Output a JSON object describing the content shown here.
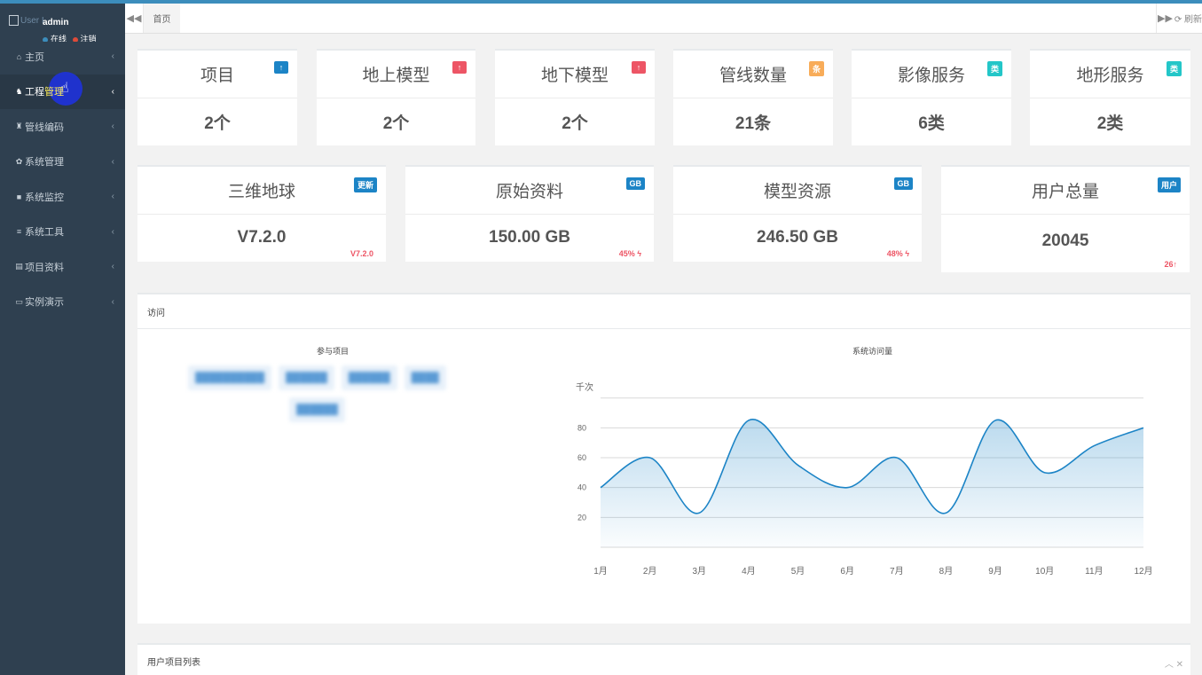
{
  "user": {
    "alt": "User I",
    "name": "admin",
    "online": "在线",
    "logout": "注销"
  },
  "menu": [
    {
      "icon": "⌂",
      "label": "主页"
    },
    {
      "icon": "♞",
      "label_a": "工程",
      "label_b": "管理"
    },
    {
      "icon": "♜",
      "label": "管线编码"
    },
    {
      "icon": "✿",
      "label": "系统管理"
    },
    {
      "icon": "■",
      "label": "系统监控"
    },
    {
      "icon": "≡",
      "label": "系统工具"
    },
    {
      "icon": "▤",
      "label": "项目资料"
    },
    {
      "icon": "▭",
      "label": "实例演示"
    }
  ],
  "tabs": {
    "home": "首页",
    "refresh": "⟳ 刷新",
    "prev": "◀◀",
    "next": "▶▶"
  },
  "stats_row1": [
    {
      "title": "项目",
      "badge": "↑",
      "badge_color": "#1c84c6",
      "value": "2个"
    },
    {
      "title": "地上模型",
      "badge": "↑",
      "badge_color": "#ed5565",
      "value": "2个"
    },
    {
      "title": "地下模型",
      "badge": "↑",
      "badge_color": "#ed5565",
      "value": "2个"
    },
    {
      "title": "管线数量",
      "badge": "条",
      "badge_color": "#f8ac59",
      "value": "21条"
    },
    {
      "title": "影像服务",
      "badge": "类",
      "badge_color": "#23c6c8",
      "value": "6类"
    },
    {
      "title": "地形服务",
      "badge": "类",
      "badge_color": "#23c6c8",
      "value": "2类"
    }
  ],
  "stats_row2": [
    {
      "title": "三维地球",
      "badge": "更新",
      "badge_color": "#1c84c6",
      "value": "V7.2.0",
      "sub": "V7.2.0"
    },
    {
      "title": "原始资料",
      "badge": "GB",
      "badge_color": "#1c84c6",
      "value": "150.00 GB",
      "sub": "45% ϟ"
    },
    {
      "title": "模型资源",
      "badge": "GB",
      "badge_color": "#1c84c6",
      "value": "246.50 GB",
      "sub": "48% ϟ"
    },
    {
      "title": "用户总量",
      "badge": "用户",
      "badge_color": "#1c84c6",
      "value": "20045",
      "sub": "26↑"
    }
  ],
  "visits": {
    "title": "访问",
    "projects_title": "参与项目",
    "projects": [
      "██████████",
      "██████",
      "██████",
      "████",
      "██████"
    ],
    "chart_title": "系统访问量"
  },
  "chart_data": {
    "type": "area",
    "title": "系统访问量",
    "ylabel": "千次",
    "categories": [
      "1月",
      "2月",
      "3月",
      "4月",
      "5月",
      "6月",
      "7月",
      "8月",
      "9月",
      "10月",
      "11月",
      "12月"
    ],
    "series": [
      {
        "values": [
          40,
          60,
          23,
          85,
          55,
          40,
          60,
          23,
          85,
          50,
          68,
          80
        ]
      }
    ],
    "yticks": [
      20,
      40,
      60,
      80
    ],
    "ylim": [
      0,
      100
    ],
    "color": "#1c84c6"
  },
  "user_list": {
    "title": "用户项目列表",
    "tools": "︿ ✕"
  }
}
